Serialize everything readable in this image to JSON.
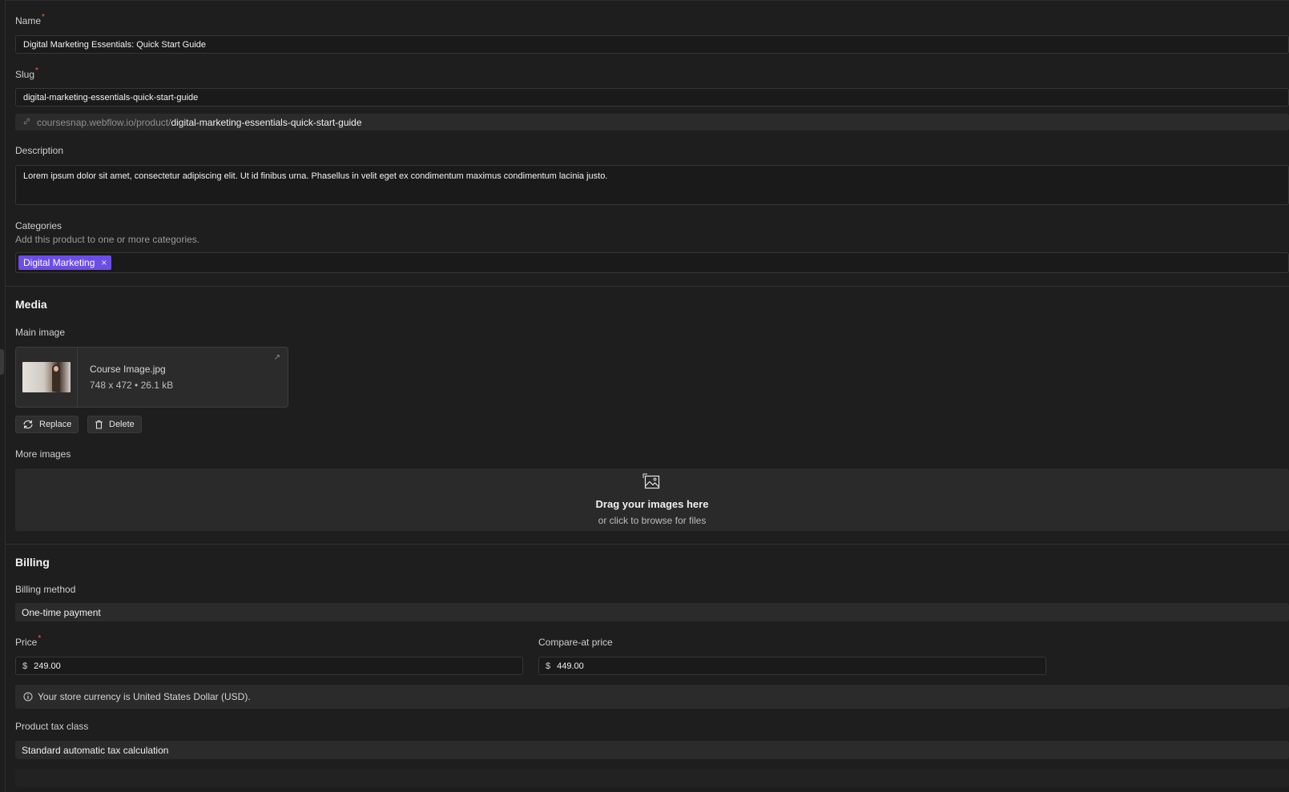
{
  "name": {
    "label": "Name",
    "required_mark": "*",
    "value": "Digital Marketing Essentials: Quick Start Guide"
  },
  "slug": {
    "label": "Slug",
    "required_mark": "*",
    "value": "digital-marketing-essentials-quick-start-guide",
    "url_prefix": "coursesnap.webflow.io/product/",
    "url_slug": "digital-marketing-essentials-quick-start-guide",
    "link_icon": "link-icon"
  },
  "description": {
    "label": "Description",
    "value": "Lorem ipsum dolor sit amet, consectetur adipiscing elit. Ut id finibus urna. Phasellus in velit eget ex condimentum maximus condimentum lacinia justo."
  },
  "categories": {
    "label": "Categories",
    "help": "Add this product to one or more categories.",
    "items": [
      {
        "label": "Digital Marketing",
        "remove": "×"
      }
    ]
  },
  "media": {
    "heading": "Media",
    "main_image_label": "Main image",
    "file_name": "Course Image.jpg",
    "file_meta": "748 x 472 • 26.1 kB",
    "expand_icon": "↗",
    "replace_label": "Replace",
    "delete_label": "Delete",
    "more_images_label": "More images",
    "drop_title": "Drag your images here",
    "drop_sub": "or click to browse for files"
  },
  "billing": {
    "heading": "Billing",
    "method_label": "Billing method",
    "method_value": "One-time payment",
    "price_label": "Price",
    "required_mark": "*",
    "currency_symbol": "$",
    "price_value": "249.00",
    "compare_label": "Compare-at price",
    "compare_value": "449.00",
    "currency_note": "Your store currency is United States Dollar (USD).",
    "tax_label": "Product tax class",
    "tax_value": "Standard automatic tax calculation"
  },
  "colors": {
    "background": "#1e1e1e",
    "chip": "#6b4ee6",
    "required": "#ff5c5c"
  }
}
